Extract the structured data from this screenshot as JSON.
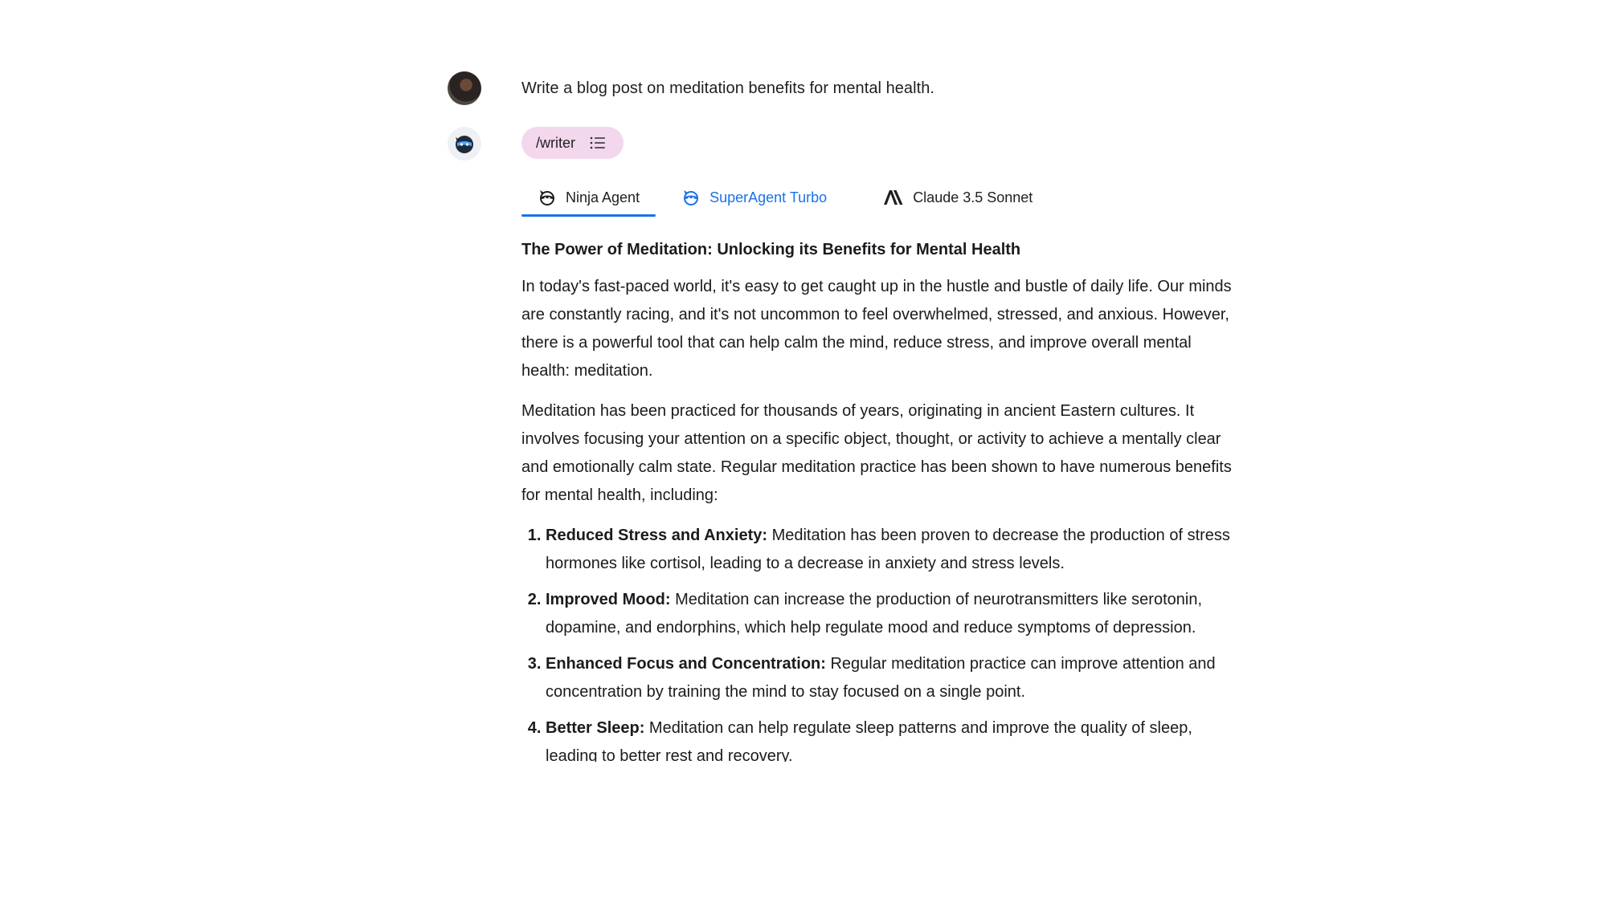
{
  "user_message": {
    "text": "Write a blog post on meditation benefits for mental health."
  },
  "assistant": {
    "skill_chip": {
      "label": "/writer",
      "icon": "list-icon"
    },
    "tabs": [
      {
        "label": "Ninja Agent",
        "icon": "ninja-agent-icon",
        "active": true
      },
      {
        "label": "SuperAgent Turbo",
        "icon": "superagent-icon",
        "active": false
      },
      {
        "label": "Claude 3.5 Sonnet",
        "icon": "anthropic-icon",
        "active": false
      }
    ],
    "colors": {
      "accent": "#1a73e8",
      "chip_bg": "#f3d7ec"
    },
    "article": {
      "title": "The Power of Meditation: Unlocking its Benefits for Mental Health",
      "paragraphs": [
        "In today's fast-paced world, it's easy to get caught up in the hustle and bustle of daily life. Our minds are constantly racing, and it's not uncommon to feel overwhelmed, stressed, and anxious. However, there is a powerful tool that can help calm the mind, reduce stress, and improve overall mental health: meditation.",
        "Meditation has been practiced for thousands of years, originating in ancient Eastern cultures. It involves focusing your attention on a specific object, thought, or activity to achieve a mentally clear and emotionally calm state. Regular meditation practice has been shown to have numerous benefits for mental health, including:"
      ],
      "benefits": [
        {
          "heading": "Reduced Stress and Anxiety:",
          "text": " Meditation has been proven to decrease the production of stress hormones like cortisol, leading to a decrease in anxiety and stress levels."
        },
        {
          "heading": "Improved Mood:",
          "text": " Meditation can increase the production of neurotransmitters like serotonin, dopamine, and endorphins, which help regulate mood and reduce symptoms of depression."
        },
        {
          "heading": "Enhanced Focus and Concentration:",
          "text": " Regular meditation practice can improve attention and concentration by training the mind to stay focused on a single point."
        },
        {
          "heading": "Better Sleep:",
          "text": " Meditation can help regulate sleep patterns and improve the quality of sleep, leading to better rest and recovery."
        }
      ]
    }
  }
}
